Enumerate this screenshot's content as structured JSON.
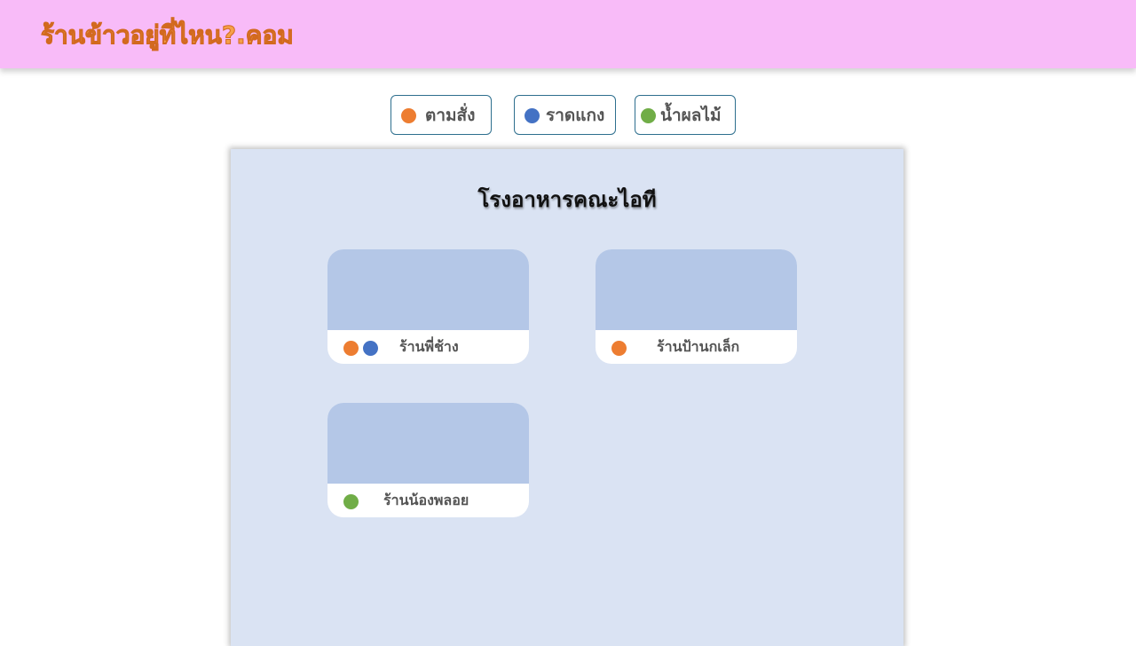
{
  "header": {
    "brand": "ร้านข้าวอยู่ที่ไหน?.คอม"
  },
  "filters": [
    {
      "label": "ตามสั่ง",
      "color": "#ed7d31"
    },
    {
      "label": "ราดแกง",
      "color": "#4472c4"
    },
    {
      "label": "น้ำผลไม้",
      "color": "#70ad47"
    }
  ],
  "panel": {
    "title": "โรงอาหารคณะไอที",
    "shops": [
      {
        "name": "ร้านพี่ช้าง",
        "tags": [
          "#ed7d31",
          "#4472c4"
        ]
      },
      {
        "name": "ร้านป้านกเล็ก",
        "tags": [
          "#ed7d31"
        ]
      },
      {
        "name": "ร้านน้องพลอย",
        "tags": [
          "#70ad47"
        ]
      }
    ]
  }
}
